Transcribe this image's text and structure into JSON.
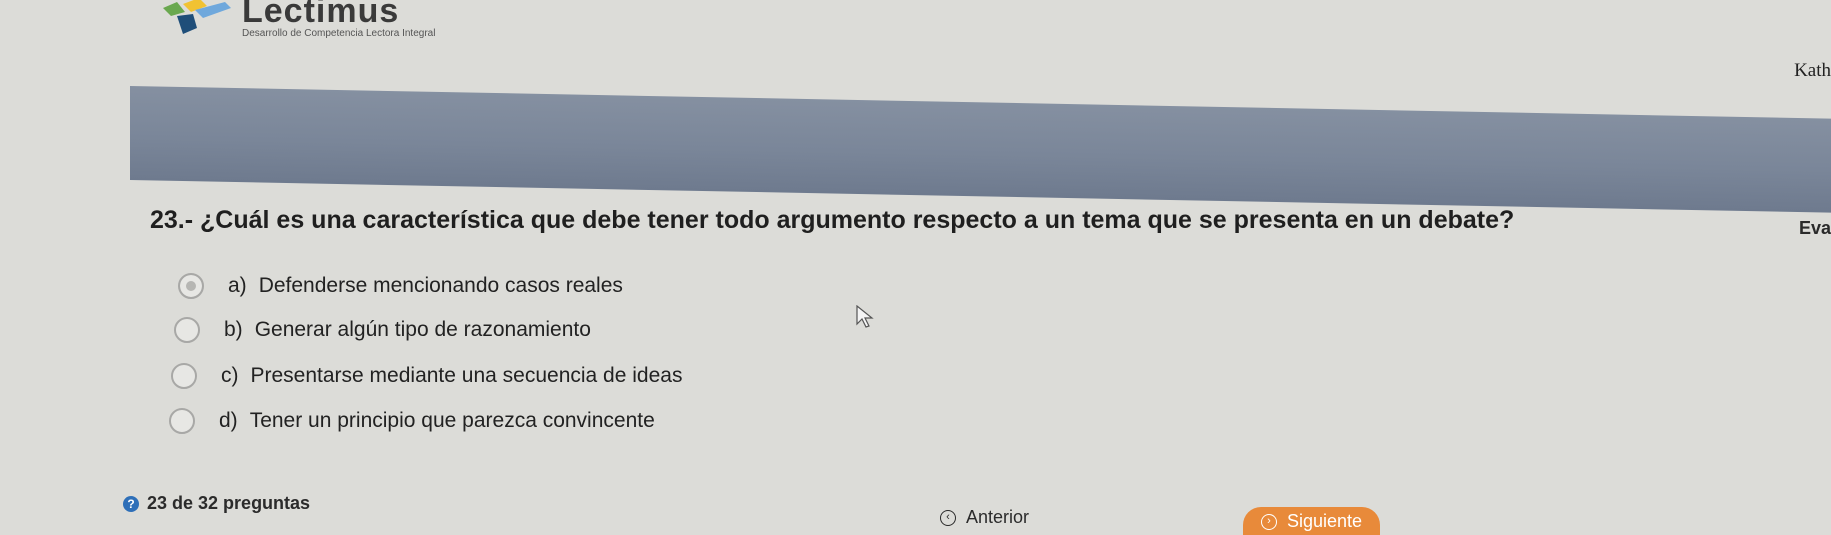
{
  "header": {
    "logo_title": "Lectimus",
    "logo_subtitle": "Desarrollo de Competencia Lectora Integral",
    "user_name": "Kath"
  },
  "question": {
    "text": "23.- ¿Cuál es una característica que debe tener todo argumento respecto a un tema que se presenta en un debate?",
    "side_label": "Eva"
  },
  "options": [
    {
      "letter": "a)",
      "text": "Defenderse mencionando casos reales",
      "selected": true
    },
    {
      "letter": "b)",
      "text": "Generar algún tipo de razonamiento",
      "selected": false
    },
    {
      "letter": "c)",
      "text": "Presentarse mediante una secuencia de ideas",
      "selected": false
    },
    {
      "letter": "d)",
      "text": "Tener un principio que parezca convincente",
      "selected": false
    }
  ],
  "footer": {
    "progress_text": "23 de 32 preguntas",
    "prev_label": "Anterior",
    "next_label": "Siguiente"
  },
  "colors": {
    "banner": "#7a8699",
    "next_button": "#e88a3a",
    "progress_icon": "#2e6fb8"
  }
}
